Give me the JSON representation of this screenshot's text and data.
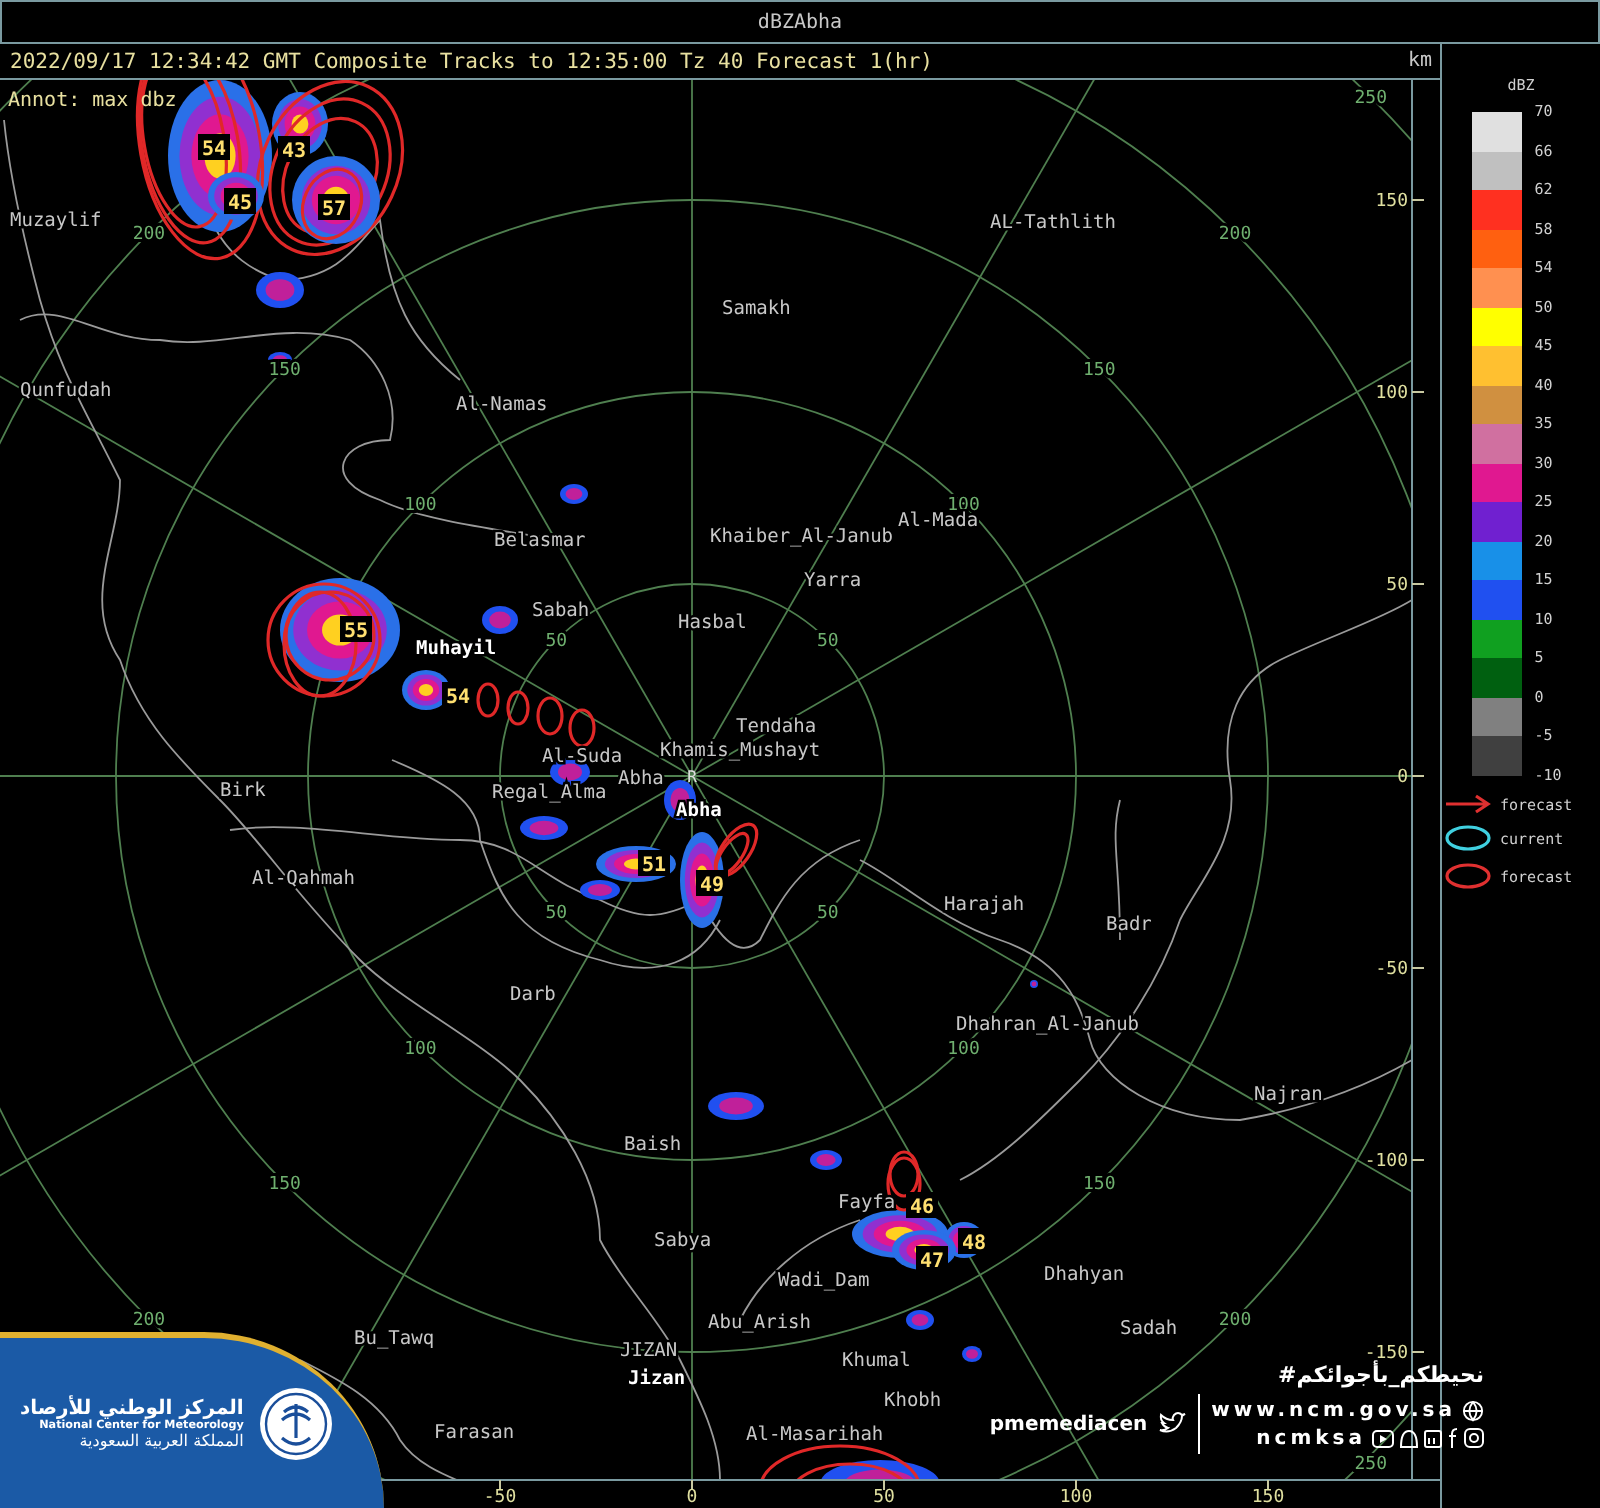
{
  "window": {
    "title": "dBZAbha"
  },
  "info_line": "2022/09/17 12:34:42 GMT Composite Tracks to 12:35:00 Tz 40 Forecast 1(hr)",
  "units": "km",
  "annotation": "Annot: max dbz",
  "site_mark": "R",
  "range_rings": [
    {
      "labels": [
        "50",
        "50",
        "50",
        "50"
      ]
    },
    {
      "labels": [
        "100",
        "100",
        "100",
        "100"
      ]
    },
    {
      "labels": [
        "150",
        "150",
        "150",
        "150"
      ]
    },
    {
      "labels": [
        "200",
        "200",
        "200",
        "200"
      ]
    },
    {
      "labels": [
        "250",
        "250"
      ]
    }
  ],
  "y_ticks": [
    "150",
    "100",
    "50",
    "0",
    "-50",
    "-100",
    "-150"
  ],
  "x_ticks": [
    "-50",
    "0",
    "50",
    "100",
    "150"
  ],
  "places": [
    {
      "name": "Muzaylif",
      "major": false
    },
    {
      "name": "AL-Tathlith",
      "major": false
    },
    {
      "name": "Samakh",
      "major": false
    },
    {
      "name": "Qunfudah",
      "major": false
    },
    {
      "name": "Al-Namas",
      "major": false
    },
    {
      "name": "Al-Mada",
      "major": false
    },
    {
      "name": "Belasmar",
      "major": false
    },
    {
      "name": "Khaiber_Al-Janub",
      "major": false
    },
    {
      "name": "Yarra",
      "major": false
    },
    {
      "name": "Sabah",
      "major": false
    },
    {
      "name": "Hasbal",
      "major": false
    },
    {
      "name": "Muhayil",
      "major": true
    },
    {
      "name": "Tendaha",
      "major": false
    },
    {
      "name": "Al-Suda",
      "major": false
    },
    {
      "name": "Khamis_Mushayt",
      "major": false
    },
    {
      "name": "Birk",
      "major": false
    },
    {
      "name": "Regal_Alma",
      "major": false
    },
    {
      "name": "Abha",
      "major": false
    },
    {
      "name": "Abha",
      "major": true
    },
    {
      "name": "Al-Qahmah",
      "major": false
    },
    {
      "name": "Harajah",
      "major": false
    },
    {
      "name": "Badr",
      "major": false
    },
    {
      "name": "Darb",
      "major": false
    },
    {
      "name": "Dhahran_Al-Janub",
      "major": false
    },
    {
      "name": "Najran",
      "major": false
    },
    {
      "name": "Baish",
      "major": false
    },
    {
      "name": "Fayfa",
      "major": false
    },
    {
      "name": "Sabya",
      "major": false
    },
    {
      "name": "Wadi_Dam",
      "major": false
    },
    {
      "name": "Dhahyan",
      "major": false
    },
    {
      "name": "Bu_Tawq",
      "major": false
    },
    {
      "name": "Abu_Arish",
      "major": false
    },
    {
      "name": "Sadah",
      "major": false
    },
    {
      "name": "JIZAN",
      "major": false
    },
    {
      "name": "Khumal",
      "major": false
    },
    {
      "name": "Jizan",
      "major": true
    },
    {
      "name": "Khobh",
      "major": false
    },
    {
      "name": "Farasan",
      "major": false
    },
    {
      "name": "Al-Masarihah",
      "major": false
    }
  ],
  "storm_cells": [
    {
      "max_dbz": "54"
    },
    {
      "max_dbz": "43"
    },
    {
      "max_dbz": "45"
    },
    {
      "max_dbz": "57"
    },
    {
      "max_dbz": "55"
    },
    {
      "max_dbz": "54"
    },
    {
      "max_dbz": "51"
    },
    {
      "max_dbz": "49"
    },
    {
      "max_dbz": "46"
    },
    {
      "max_dbz": "48"
    },
    {
      "max_dbz": "47"
    }
  ],
  "legend": {
    "title": "dBZ",
    "bins": [
      {
        "color": "#e0e0e0"
      },
      {
        "color": "#c0c0c0"
      },
      {
        "color": "#ff3020"
      },
      {
        "color": "#ff6010"
      },
      {
        "color": "#ff9050"
      },
      {
        "color": "#ffff00"
      },
      {
        "color": "#ffc030"
      },
      {
        "color": "#d09040"
      },
      {
        "color": "#d070a0"
      },
      {
        "color": "#e01890"
      },
      {
        "color": "#7020d0"
      },
      {
        "color": "#1890e8"
      },
      {
        "color": "#2050f0"
      },
      {
        "color": "#10a020"
      },
      {
        "color": "#006010"
      },
      {
        "color": "#808080"
      },
      {
        "color": "#404040"
      }
    ],
    "ticks": [
      "70",
      "66",
      "62",
      "58",
      "54",
      "50",
      "45",
      "40",
      "35",
      "30",
      "25",
      "20",
      "15",
      "10",
      "5",
      "0",
      "-5",
      "-10"
    ],
    "symbols": [
      {
        "kind": "arrow",
        "color": "#e03030",
        "label": "forecast"
      },
      {
        "kind": "ellipse",
        "color": "#40d0e0",
        "label": "current"
      },
      {
        "kind": "ellipse",
        "color": "#e03030",
        "label": "forecast"
      }
    ]
  },
  "branding": {
    "org_arabic": "المركز الوطني للأرصاد",
    "org_english": "National Center for Meteorology",
    "country_arabic": "المملكة العربية السعودية",
    "hashtag": "#نحيطكم_بأجوائكم",
    "twitter": "pmemediacen",
    "website": "www.ncm.gov.sa",
    "handle": "ncmksa"
  }
}
